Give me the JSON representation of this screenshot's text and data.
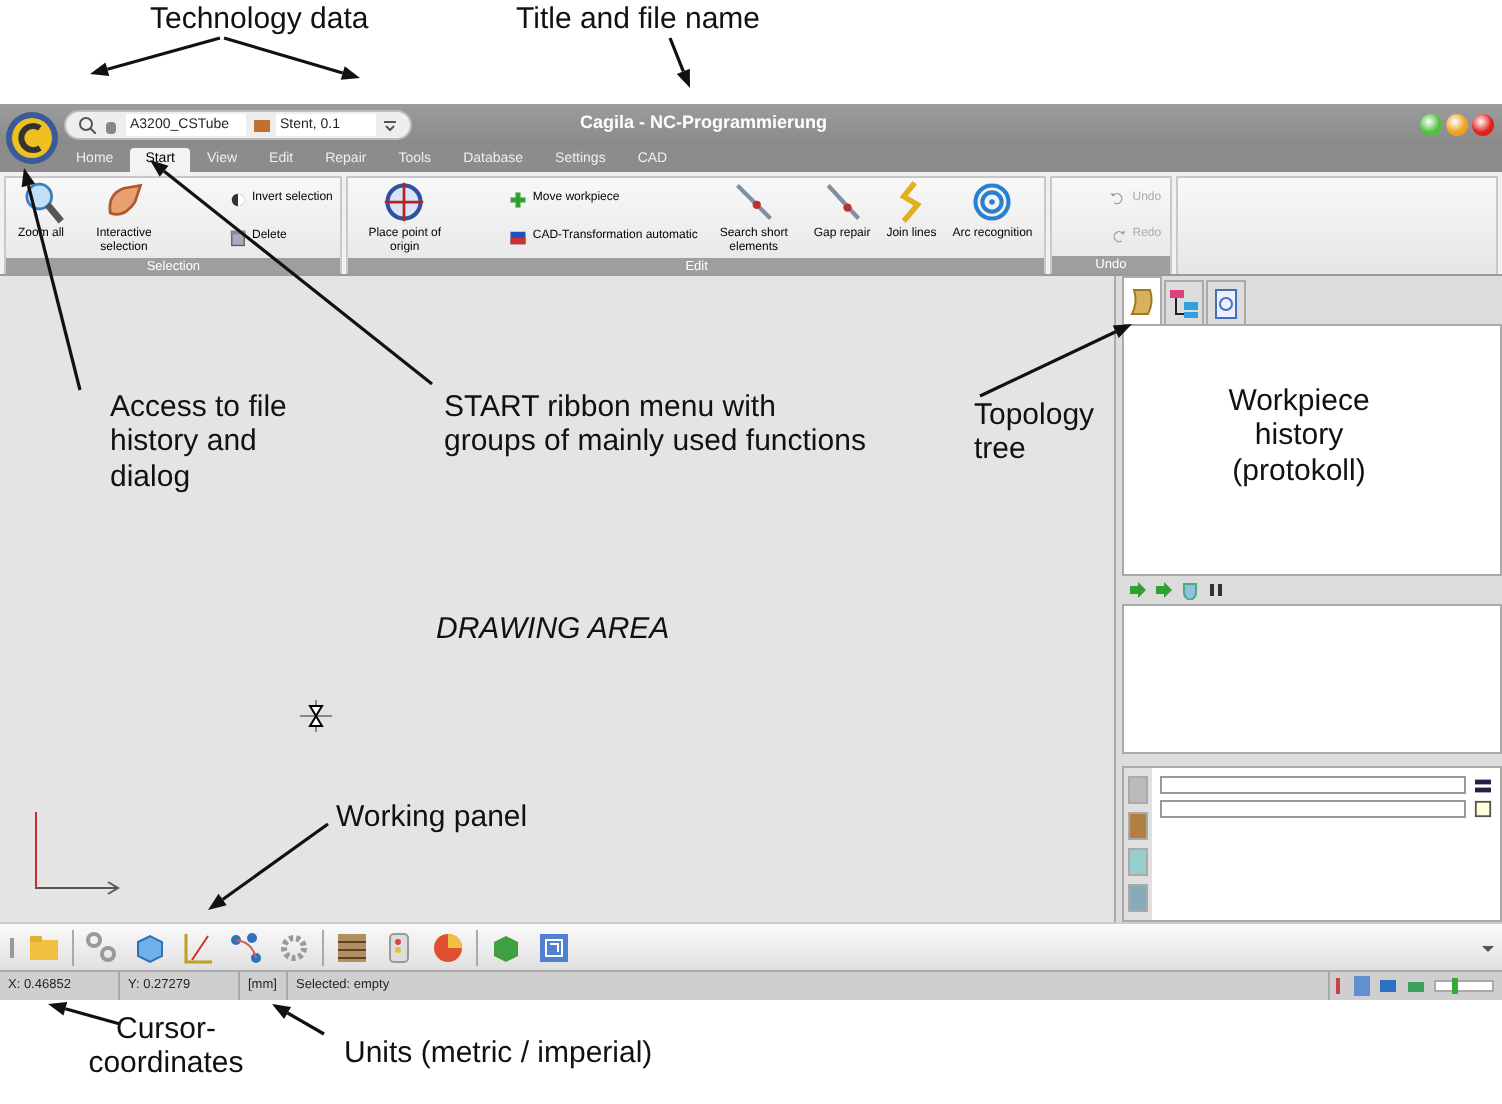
{
  "annotations": [
    {
      "text": "Technology data"
    },
    {
      "text": "Title and file name"
    },
    {
      "text": "Access to file history and dialog"
    },
    {
      "text": "START ribbon menu with groups of mainly used functions"
    },
    {
      "text": "Topology tree"
    },
    {
      "text": "Workpiece history (protokoll)"
    },
    {
      "text": "DRAWING AREA"
    },
    {
      "text": "Working panel"
    },
    {
      "text": "Cursor-coordinates"
    },
    {
      "text": "Units (metric / imperial)"
    }
  ],
  "window": {
    "file_field": "A3200_CSTube",
    "tech_field": "Stent, 0.1",
    "title": "Cagila - NC-Programmierung"
  },
  "menu_tabs": [
    {
      "label": "Home",
      "selected": false
    },
    {
      "label": "Start",
      "selected": true
    },
    {
      "label": "View",
      "selected": false
    },
    {
      "label": "Edit",
      "selected": false
    },
    {
      "label": "Repair",
      "selected": false
    },
    {
      "label": "Tools",
      "selected": false
    },
    {
      "label": "Database",
      "selected": false
    },
    {
      "label": "Settings",
      "selected": false
    },
    {
      "label": "CAD",
      "selected": false
    }
  ],
  "ribbon_groups": [
    {
      "title": "Selection",
      "items": [
        {
          "kind": "large",
          "label": "Zoom all",
          "disabled": false
        },
        {
          "kind": "large",
          "label": "Interactive selection",
          "disabled": false
        },
        {
          "kind": "small",
          "label": "Invert selection",
          "disabled": false
        },
        {
          "kind": "small",
          "label": "Delete",
          "disabled": false
        }
      ]
    },
    {
      "title": "Edit",
      "items": [
        {
          "kind": "large",
          "label": "Place point of origin",
          "disabled": false
        },
        {
          "kind": "small",
          "label": "Move workpiece",
          "disabled": false
        },
        {
          "kind": "small",
          "label": "CAD-Transformation automatic",
          "disabled": false
        },
        {
          "kind": "large",
          "label": "Search short elements",
          "disabled": false
        },
        {
          "kind": "large",
          "label": "Gap repair",
          "disabled": false
        },
        {
          "kind": "large",
          "label": "Join lines",
          "disabled": false
        },
        {
          "kind": "large",
          "label": "Arc recognition",
          "disabled": false
        }
      ]
    },
    {
      "title": "Undo",
      "items": [
        {
          "kind": "small",
          "label": "Undo",
          "disabled": true
        },
        {
          "kind": "small",
          "label": "Redo",
          "disabled": true
        }
      ]
    }
  ],
  "side_panel_tabs": [
    {
      "selected": true
    },
    {
      "selected": false
    },
    {
      "selected": false
    }
  ],
  "status_bar": [
    "X: 0.46852",
    "Y: 0.27279",
    "[mm]",
    "Selected: empty"
  ],
  "zoom_slider": {
    "level": 0.3
  }
}
